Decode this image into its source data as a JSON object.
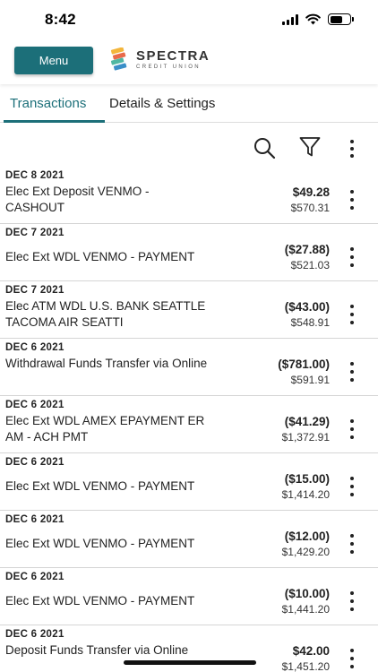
{
  "status_bar": {
    "time": "8:42"
  },
  "header": {
    "menu_label": "Menu",
    "logo_name": "SPECTRA",
    "logo_sub": "CREDIT UNION"
  },
  "tabs": [
    {
      "label": "Transactions",
      "active": true
    },
    {
      "label": "Details & Settings",
      "active": false
    }
  ],
  "toolbar": {
    "icons": [
      "search-icon",
      "filter-icon",
      "more-vertical-icon"
    ]
  },
  "colors": {
    "accent": "#1c6f79"
  },
  "transactions": [
    {
      "date": "DEC 8 2021",
      "description": "Elec Ext Deposit VENMO - CASHOUT",
      "amount": "$49.28",
      "balance": "$570.31"
    },
    {
      "date": "DEC 7 2021",
      "description": "Elec Ext WDL VENMO - PAYMENT",
      "amount": "($27.88)",
      "balance": "$521.03"
    },
    {
      "date": "DEC 7 2021",
      "description": "Elec ATM WDL U.S. BANK SEATTLE TACOMA AIR SEATTI",
      "amount": "($43.00)",
      "balance": "$548.91"
    },
    {
      "date": "DEC 6 2021",
      "description": "Withdrawal Funds Transfer via Online",
      "amount": "($781.00)",
      "balance": "$591.91"
    },
    {
      "date": "DEC 6 2021",
      "description": "Elec Ext WDL AMEX EPAYMENT ER AM - ACH PMT",
      "amount": "($41.29)",
      "balance": "$1,372.91"
    },
    {
      "date": "DEC 6 2021",
      "description": "Elec Ext WDL VENMO - PAYMENT",
      "amount": "($15.00)",
      "balance": "$1,414.20"
    },
    {
      "date": "DEC 6 2021",
      "description": "Elec Ext WDL VENMO - PAYMENT",
      "amount": "($12.00)",
      "balance": "$1,429.20"
    },
    {
      "date": "DEC 6 2021",
      "description": "Elec Ext WDL VENMO - PAYMENT",
      "amount": "($10.00)",
      "balance": "$1,441.20"
    },
    {
      "date": "DEC 6 2021",
      "description": "Deposit Funds Transfer via Online",
      "amount": "$42.00",
      "balance": "$1,451.20"
    }
  ]
}
